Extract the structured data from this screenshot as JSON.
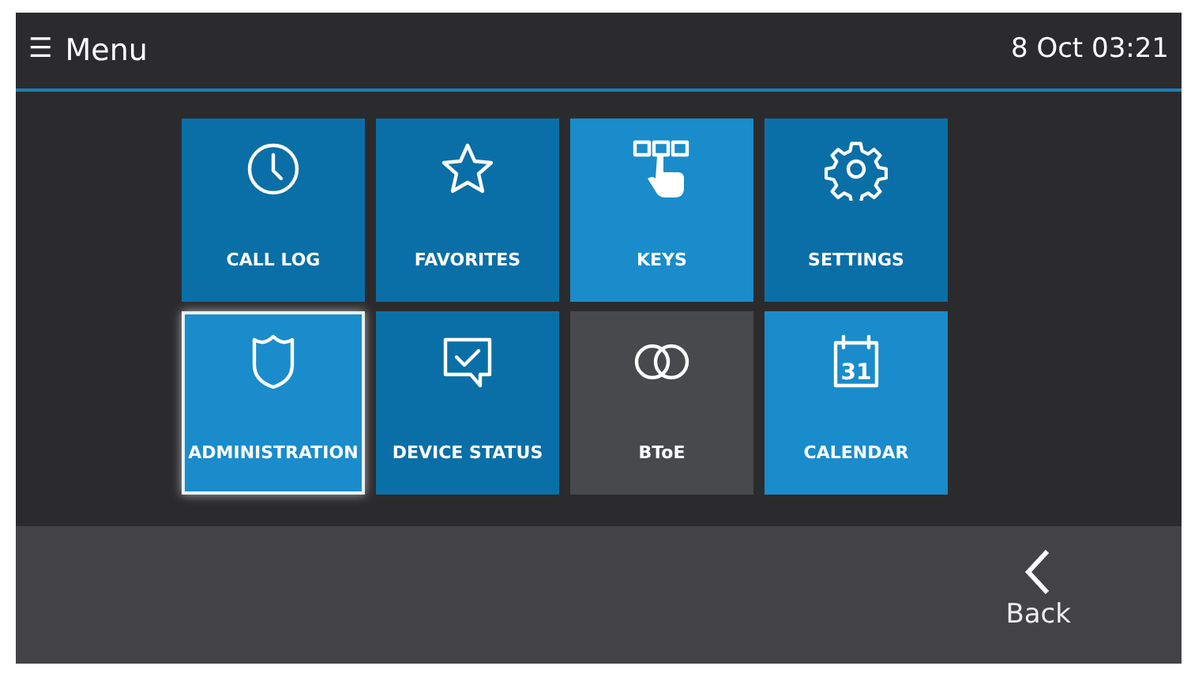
{
  "header": {
    "menu_icon": "☰",
    "title": "Menu",
    "datetime": "8 Oct 03:21"
  },
  "tiles": [
    {
      "kind": "clock",
      "label": "CALL LOG",
      "color": "#0b6fa7",
      "selected": false
    },
    {
      "kind": "star",
      "label": "FAVORITES",
      "color": "#0b6fa7",
      "selected": false
    },
    {
      "kind": "keys",
      "label": "KEYS",
      "color": "#1a8ccb",
      "selected": false
    },
    {
      "kind": "gear",
      "label": "SETTINGS",
      "color": "#0b6fa7",
      "selected": false
    },
    {
      "kind": "shield",
      "label": "ADMINISTRATION",
      "color": "#1a8ccb",
      "selected": true
    },
    {
      "kind": "chat",
      "label": "DEVICE STATUS",
      "color": "#0b6fa7",
      "selected": false
    },
    {
      "kind": "rings",
      "label": "BToE",
      "color": "#48494d",
      "selected": false
    },
    {
      "kind": "calendar",
      "label": "CALENDAR",
      "color": "#1a8ccb",
      "selected": false,
      "icon_text": "31"
    }
  ],
  "footer": {
    "back_label": "Back"
  }
}
